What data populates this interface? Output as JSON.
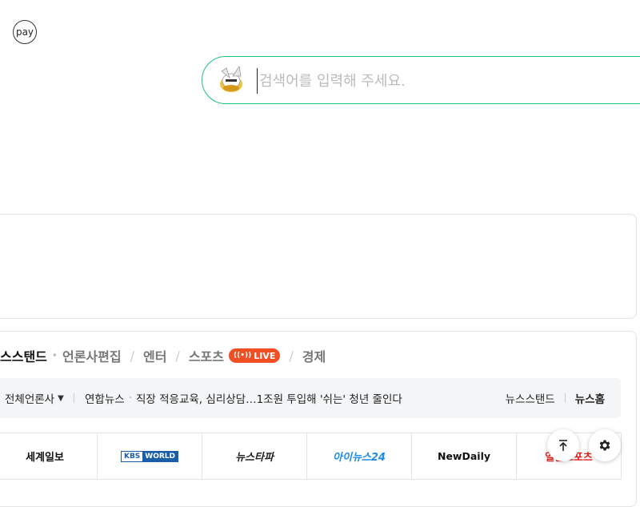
{
  "pay": {
    "label": "pay"
  },
  "search": {
    "placeholder": "검색어를 입력해 주세요."
  },
  "news": {
    "tabs": [
      {
        "label": "스스탠드"
      },
      {
        "label": "언론사편집"
      },
      {
        "label": "엔터"
      },
      {
        "label": "스포츠"
      },
      {
        "label": "경제"
      }
    ],
    "live_label": "LIVE",
    "press_select_label": "전체언론사",
    "headline_press": "연합뉴스",
    "headline_text": "직장 적응교육, 심리상담…1조원 투입해 '쉬는' 청년 줄인다",
    "right_links": [
      {
        "label": "뉴스스탠드"
      },
      {
        "label": "뉴스홈"
      }
    ],
    "logos": [
      {
        "name": "세계일보"
      },
      {
        "name_kbs": "KBS",
        "name_world": "WORLD"
      },
      {
        "name": "뉴스타파"
      },
      {
        "name": "아이뉴스24"
      },
      {
        "name": "NewDaily"
      },
      {
        "name": "일간스포츠"
      }
    ]
  },
  "colors": {
    "search_border": "#19c37d",
    "live_badge": "#f04e23"
  }
}
